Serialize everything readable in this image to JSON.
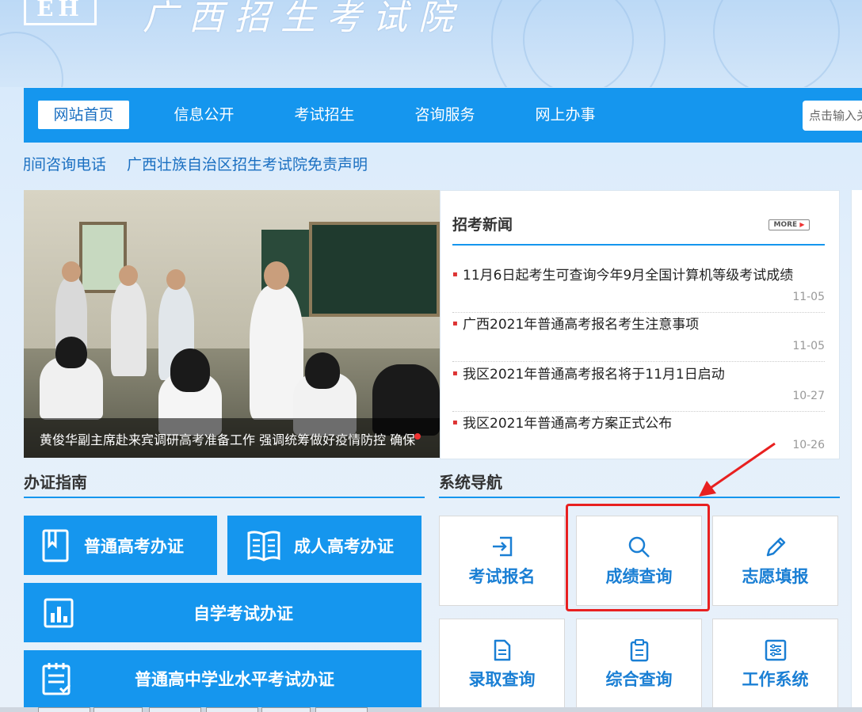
{
  "header": {
    "logo_text": "EH",
    "site_title": "广西招生考试院"
  },
  "nav": {
    "items": [
      {
        "label": "网站首页",
        "active": true
      },
      {
        "label": "信息公开"
      },
      {
        "label": "考试招生"
      },
      {
        "label": "咨询服务"
      },
      {
        "label": "网上办事"
      }
    ],
    "search_placeholder": "点击输入关"
  },
  "marquee": [
    "期间咨询电话",
    "广西壮族自治区招生考试院免责声明"
  ],
  "slideshow": {
    "caption": "黄俊华副主席赴来宾调研高考准备工作 强调统筹做好疫情防控 确保"
  },
  "news": {
    "title": "招考新闻",
    "more_label": "MORE",
    "items": [
      {
        "text": "11月6日起考生可查询今年9月全国计算机等级考试成绩",
        "date": "11-05"
      },
      {
        "text": "广西2021年普通高考报名考生注意事项",
        "date": "11-05"
      },
      {
        "text": "我区2021年普通高考报名将于11月1日启动",
        "date": "10-27"
      },
      {
        "text": "我区2021年普通高考方案正式公布",
        "date": "10-26"
      }
    ]
  },
  "guide": {
    "title": "办证指南",
    "buttons": [
      {
        "label": "普通高考办证",
        "icon": "book-icon"
      },
      {
        "label": "成人高考办证",
        "icon": "open-book-icon"
      },
      {
        "label": "自学考试办证",
        "icon": "chart-icon"
      },
      {
        "label": "普通高中学业水平考试办证",
        "icon": "checklist-icon"
      }
    ]
  },
  "system_nav": {
    "title": "系统导航",
    "items": [
      {
        "label": "考试报名",
        "icon": "login-icon"
      },
      {
        "label": "成绩查询",
        "icon": "search-icon"
      },
      {
        "label": "志愿填报",
        "icon": "pencil-icon"
      },
      {
        "label": "录取查询",
        "icon": "document-icon"
      },
      {
        "label": "综合查询",
        "icon": "clipboard-icon"
      },
      {
        "label": "工作系统",
        "icon": "settings-sliders-icon"
      }
    ]
  },
  "colors": {
    "primary": "#1596ee",
    "link": "#1a6fc1",
    "annotation": "#e82020"
  }
}
